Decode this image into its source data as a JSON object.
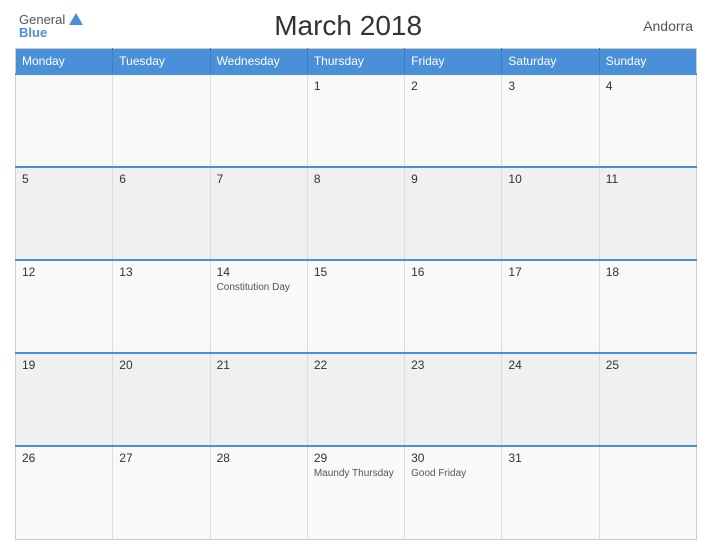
{
  "header": {
    "logo_general": "General",
    "logo_blue": "Blue",
    "title": "March 2018",
    "country": "Andorra"
  },
  "calendar": {
    "days_of_week": [
      "Monday",
      "Tuesday",
      "Wednesday",
      "Thursday",
      "Friday",
      "Saturday",
      "Sunday"
    ],
    "weeks": [
      [
        {
          "day": "",
          "events": []
        },
        {
          "day": "",
          "events": []
        },
        {
          "day": "",
          "events": []
        },
        {
          "day": "1",
          "events": []
        },
        {
          "day": "2",
          "events": []
        },
        {
          "day": "3",
          "events": []
        },
        {
          "day": "4",
          "events": []
        }
      ],
      [
        {
          "day": "5",
          "events": []
        },
        {
          "day": "6",
          "events": []
        },
        {
          "day": "7",
          "events": []
        },
        {
          "day": "8",
          "events": []
        },
        {
          "day": "9",
          "events": []
        },
        {
          "day": "10",
          "events": []
        },
        {
          "day": "11",
          "events": []
        }
      ],
      [
        {
          "day": "12",
          "events": []
        },
        {
          "day": "13",
          "events": []
        },
        {
          "day": "14",
          "events": [
            "Constitution Day"
          ]
        },
        {
          "day": "15",
          "events": []
        },
        {
          "day": "16",
          "events": []
        },
        {
          "day": "17",
          "events": []
        },
        {
          "day": "18",
          "events": []
        }
      ],
      [
        {
          "day": "19",
          "events": []
        },
        {
          "day": "20",
          "events": []
        },
        {
          "day": "21",
          "events": []
        },
        {
          "day": "22",
          "events": []
        },
        {
          "day": "23",
          "events": []
        },
        {
          "day": "24",
          "events": []
        },
        {
          "day": "25",
          "events": []
        }
      ],
      [
        {
          "day": "26",
          "events": []
        },
        {
          "day": "27",
          "events": []
        },
        {
          "day": "28",
          "events": []
        },
        {
          "day": "29",
          "events": [
            "Maundy Thursday"
          ]
        },
        {
          "day": "30",
          "events": [
            "Good Friday"
          ]
        },
        {
          "day": "31",
          "events": []
        },
        {
          "day": "",
          "events": []
        }
      ]
    ]
  }
}
